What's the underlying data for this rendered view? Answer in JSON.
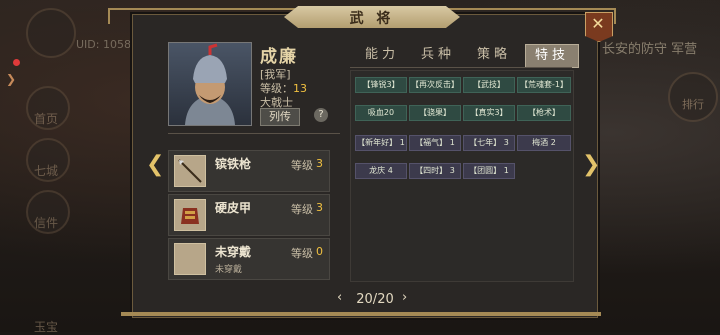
{
  "panel": {
    "title": "武 将",
    "close_icon": "close-x-icon"
  },
  "background": {
    "uid": "UID: 1058",
    "left_labels": [
      "首页",
      "七城",
      "信件",
      "玉宝"
    ],
    "right_text": "长安的防守 军营",
    "right_label": "排行"
  },
  "hero": {
    "name": "成廉",
    "faction": "[我军]",
    "level_label": "等级：",
    "level_value": "13",
    "rank": "大戟士",
    "bio_button": "列传",
    "help": "?"
  },
  "equipment": [
    {
      "name": "镔铁枪",
      "level_label": "等级",
      "level": "3",
      "sub": "",
      "icon": "spear-icon"
    },
    {
      "name": "硬皮甲",
      "level_label": "等级",
      "level": "3",
      "sub": "",
      "icon": "armor-icon"
    },
    {
      "name": "未穿戴",
      "level_label": "等级",
      "level": "0",
      "sub": "未穿戴",
      "icon": "empty-slot-icon"
    }
  ],
  "tabs": [
    "能力",
    "兵种",
    "策略",
    "特技"
  ],
  "active_tab": 3,
  "skills": [
    {
      "label": "【锋锐3】",
      "style": "teal"
    },
    {
      "label": "【再次反击】",
      "style": "teal"
    },
    {
      "label": "【武技】",
      "style": "teal"
    },
    {
      "label": "【荒魂套-1】",
      "style": "teal"
    },
    {
      "label": "吸血20",
      "style": "teal"
    },
    {
      "label": "【骁果】",
      "style": "teal"
    },
    {
      "label": "【真实3】",
      "style": "teal"
    },
    {
      "label": "【枪术】",
      "style": "teal"
    },
    {
      "label": "【新年好】 1",
      "style": "purple"
    },
    {
      "label": "【福气】 1",
      "style": "purple"
    },
    {
      "label": "【七年】 3",
      "style": "purple"
    },
    {
      "label": "梅酒 2",
      "style": "purple"
    },
    {
      "label": "龙庆 4",
      "style": "purple"
    },
    {
      "label": "【四时】 3",
      "style": "purple"
    },
    {
      "label": "【团圆】 1",
      "style": "purple"
    }
  ],
  "pager": {
    "text": "20/20",
    "prev": "‹",
    "next": "›"
  },
  "nav": {
    "prev": "❮",
    "next": "❯"
  }
}
